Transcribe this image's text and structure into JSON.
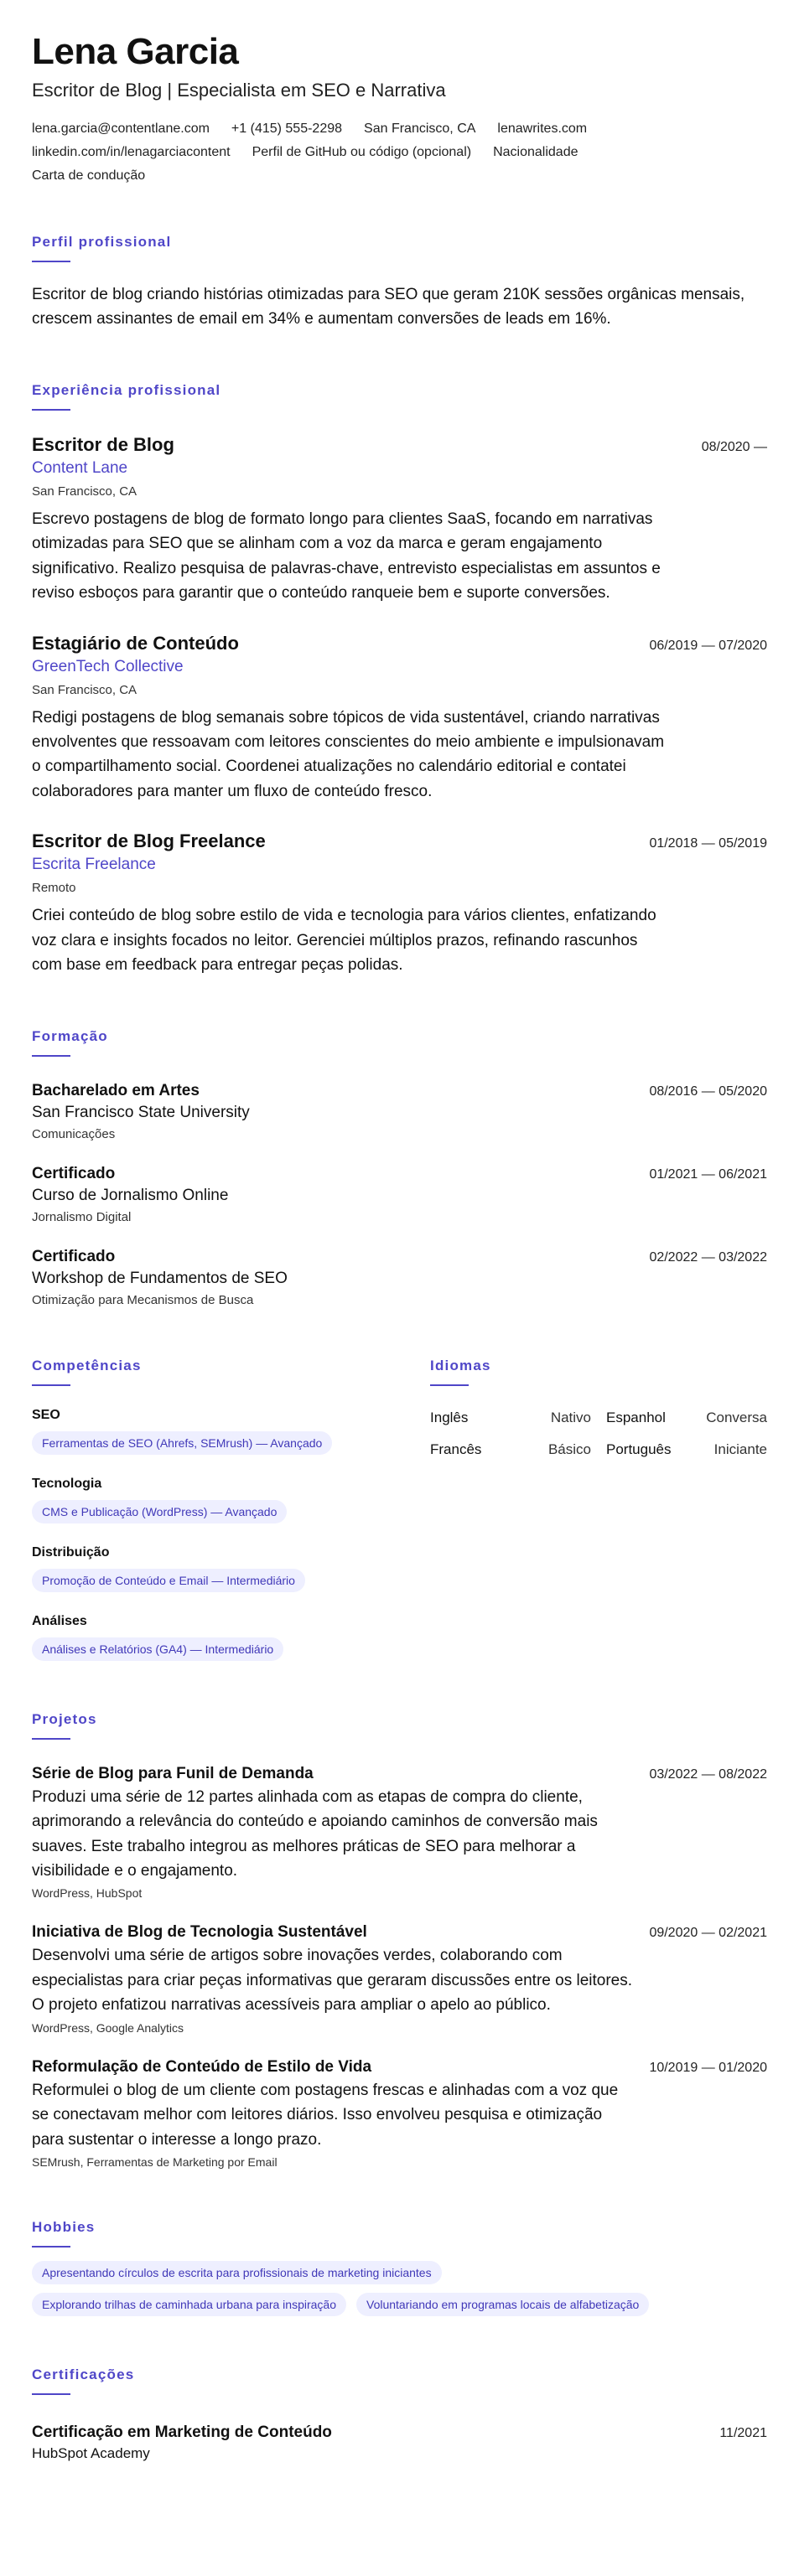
{
  "header": {
    "name": "Lena Garcia",
    "headline": "Escritor de Blog | Especialista em SEO e Narrativa",
    "contacts": [
      "lena.garcia@contentlane.com",
      "+1 (415) 555-2298",
      "San Francisco, CA",
      "lenawrites.com",
      "linkedin.com/in/lenagarciacontent",
      "Perfil de GitHub ou código (opcional)",
      "Nacionalidade",
      "Carta de condução"
    ]
  },
  "profile": {
    "title": "Perfil profissional",
    "text": "Escritor de blog criando histórias otimizadas para SEO que geram 210K sessões orgânicas mensais, crescem assinantes de email em 34% e aumentam conversões de leads em 16%."
  },
  "experience": {
    "title": "Experiência profissional",
    "items": [
      {
        "role": "Escritor de Blog",
        "company": "Content Lane",
        "location": "San Francisco, CA",
        "dates": "08/2020 —",
        "description": "Escrevo postagens de blog de formato longo para clientes SaaS, focando em narrativas otimizadas para SEO que se alinham com a voz da marca e geram engajamento significativo. Realizo pesquisa de palavras-chave, entrevisto especialistas em assuntos e reviso esboços para garantir que o conteúdo ranqueie bem e suporte conversões."
      },
      {
        "role": "Estagiário de Conteúdo",
        "company": "GreenTech Collective",
        "location": "San Francisco, CA",
        "dates": "06/2019 — 07/2020",
        "description": "Redigi postagens de blog semanais sobre tópicos de vida sustentável, criando narrativas envolventes que ressoavam com leitores conscientes do meio ambiente e impulsionavam o compartilhamento social. Coordenei atualizações no calendário editorial e contatei colaboradores para manter um fluxo de conteúdo fresco."
      },
      {
        "role": "Escritor de Blog Freelance",
        "company": "Escrita Freelance",
        "location": "Remoto",
        "dates": "01/2018 — 05/2019",
        "description": "Criei conteúdo de blog sobre estilo de vida e tecnologia para vários clientes, enfatizando voz clara e insights focados no leitor. Gerenciei múltiplos prazos, refinando rascunhos com base em feedback para entregar peças polidas."
      }
    ]
  },
  "education": {
    "title": "Formação",
    "items": [
      {
        "degree": "Bacharelado em Artes",
        "institution": "San Francisco State University",
        "field": "Comunicações",
        "dates": "08/2016 — 05/2020"
      },
      {
        "degree": "Certificado",
        "institution": "Curso de Jornalismo Online",
        "field": "Jornalismo Digital",
        "dates": "01/2021 — 06/2021"
      },
      {
        "degree": "Certificado",
        "institution": "Workshop de Fundamentos de SEO",
        "field": "Otimização para Mecanismos de Busca",
        "dates": "02/2022 — 03/2022"
      }
    ]
  },
  "skills": {
    "title": "Competências",
    "groups": [
      {
        "name": "SEO",
        "chip": "Ferramentas de SEO (Ahrefs, SEMrush) — Avançado"
      },
      {
        "name": "Tecnologia",
        "chip": "CMS e Publicação (WordPress) — Avançado"
      },
      {
        "name": "Distribuição",
        "chip": "Promoção de Conteúdo e Email — Intermediário"
      },
      {
        "name": "Análises",
        "chip": "Análises e Relatórios (GA4) — Intermediário"
      }
    ]
  },
  "languages": {
    "title": "Idiomas",
    "items": [
      {
        "name": "Inglês",
        "level": "Nativo"
      },
      {
        "name": "Espanhol",
        "level": "Conversa"
      },
      {
        "name": "Francês",
        "level": "Básico"
      },
      {
        "name": "Português",
        "level": "Iniciante"
      }
    ]
  },
  "projects": {
    "title": "Projetos",
    "items": [
      {
        "name": "Série de Blog para Funil de Demanda",
        "dates": "03/2022 — 08/2022",
        "description": "Produzi uma série de 12 partes alinhada com as etapas de compra do cliente, aprimorando a relevância do conteúdo e apoiando caminhos de conversão mais suaves. Este trabalho integrou as melhores práticas de SEO para melhorar a visibilidade e o engajamento.",
        "tech": "WordPress, HubSpot"
      },
      {
        "name": "Iniciativa de Blog de Tecnologia Sustentável",
        "dates": "09/2020 — 02/2021",
        "description": "Desenvolvi uma série de artigos sobre inovações verdes, colaborando com especialistas para criar peças informativas que geraram discussões entre os leitores. O projeto enfatizou narrativas acessíveis para ampliar o apelo ao público.",
        "tech": "WordPress, Google Analytics"
      },
      {
        "name": "Reformulação de Conteúdo de Estilo de Vida",
        "dates": "10/2019 — 01/2020",
        "description": "Reformulei o blog de um cliente com postagens frescas e alinhadas com a voz que se conectavam melhor com leitores diários. Isso envolveu pesquisa e otimização para sustentar o interesse a longo prazo.",
        "tech": "SEMrush, Ferramentas de Marketing por Email"
      }
    ]
  },
  "hobbies": {
    "title": "Hobbies",
    "items": [
      "Apresentando círculos de escrita para profissionais de marketing iniciantes",
      "Explorando trilhas de caminhada urbana para inspiração",
      "Voluntariando em programas locais de alfabetização"
    ]
  },
  "certifications": {
    "title": "Certificações",
    "items": [
      {
        "name": "Certificação em Marketing de Conteúdo",
        "issuer": "HubSpot Academy",
        "date": "11/2021"
      }
    ]
  }
}
